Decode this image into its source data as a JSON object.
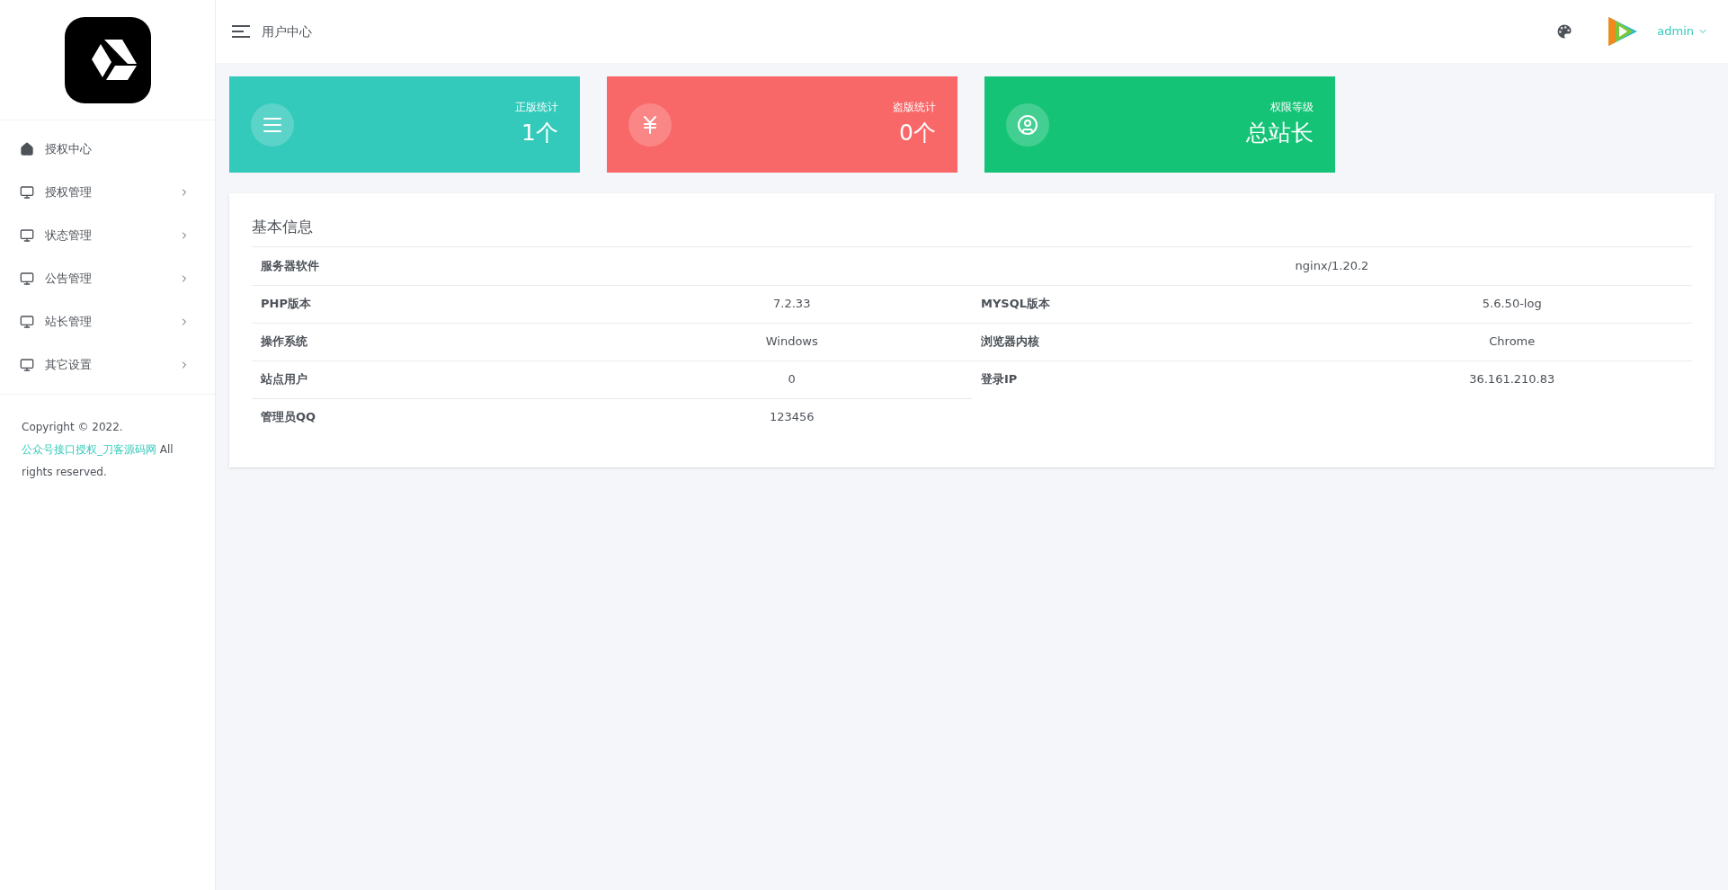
{
  "sidebar": {
    "menu": [
      {
        "label": "授权中心",
        "kind": "home",
        "expandable": false
      },
      {
        "label": "授权管理",
        "kind": "monitor",
        "expandable": true
      },
      {
        "label": "状态管理",
        "kind": "monitor",
        "expandable": true
      },
      {
        "label": "公告管理",
        "kind": "monitor",
        "expandable": true
      },
      {
        "label": "站长管理",
        "kind": "monitor",
        "expandable": true
      },
      {
        "label": "其它设置",
        "kind": "monitor",
        "expandable": true
      }
    ],
    "footer": {
      "before": "Copyright © 2022.",
      "link": "公众号接口授权_刀客源码网",
      "after": "All rights reserved."
    }
  },
  "header": {
    "title": "用户中心",
    "user": "admin"
  },
  "stats": [
    {
      "label": "正版统计",
      "value": "1个",
      "kind": "list",
      "color": "#33c9bb"
    },
    {
      "label": "盗版统计",
      "value": "0个",
      "kind": "yen",
      "color": "#f96868"
    },
    {
      "label": "权限等级",
      "value": "总站长",
      "kind": "user",
      "color": "#15c377"
    }
  ],
  "info": {
    "title": "基本信息",
    "rows": [
      [
        {
          "label": "服务器软件",
          "value": "nginx/1.20.2"
        }
      ],
      [
        {
          "label": "PHP版本",
          "value": "7.2.33"
        },
        {
          "label": "MYSQL版本",
          "value": "5.6.50-log"
        }
      ],
      [
        {
          "label": "操作系统",
          "value": "Windows"
        },
        {
          "label": "浏览器内核",
          "value": "Chrome"
        }
      ],
      [
        {
          "label": "站点用户",
          "value": "0"
        },
        {
          "label": "登录IP",
          "value": "36.161.210.83"
        }
      ],
      [
        {
          "label": "管理员QQ",
          "value": "123456"
        }
      ]
    ]
  }
}
